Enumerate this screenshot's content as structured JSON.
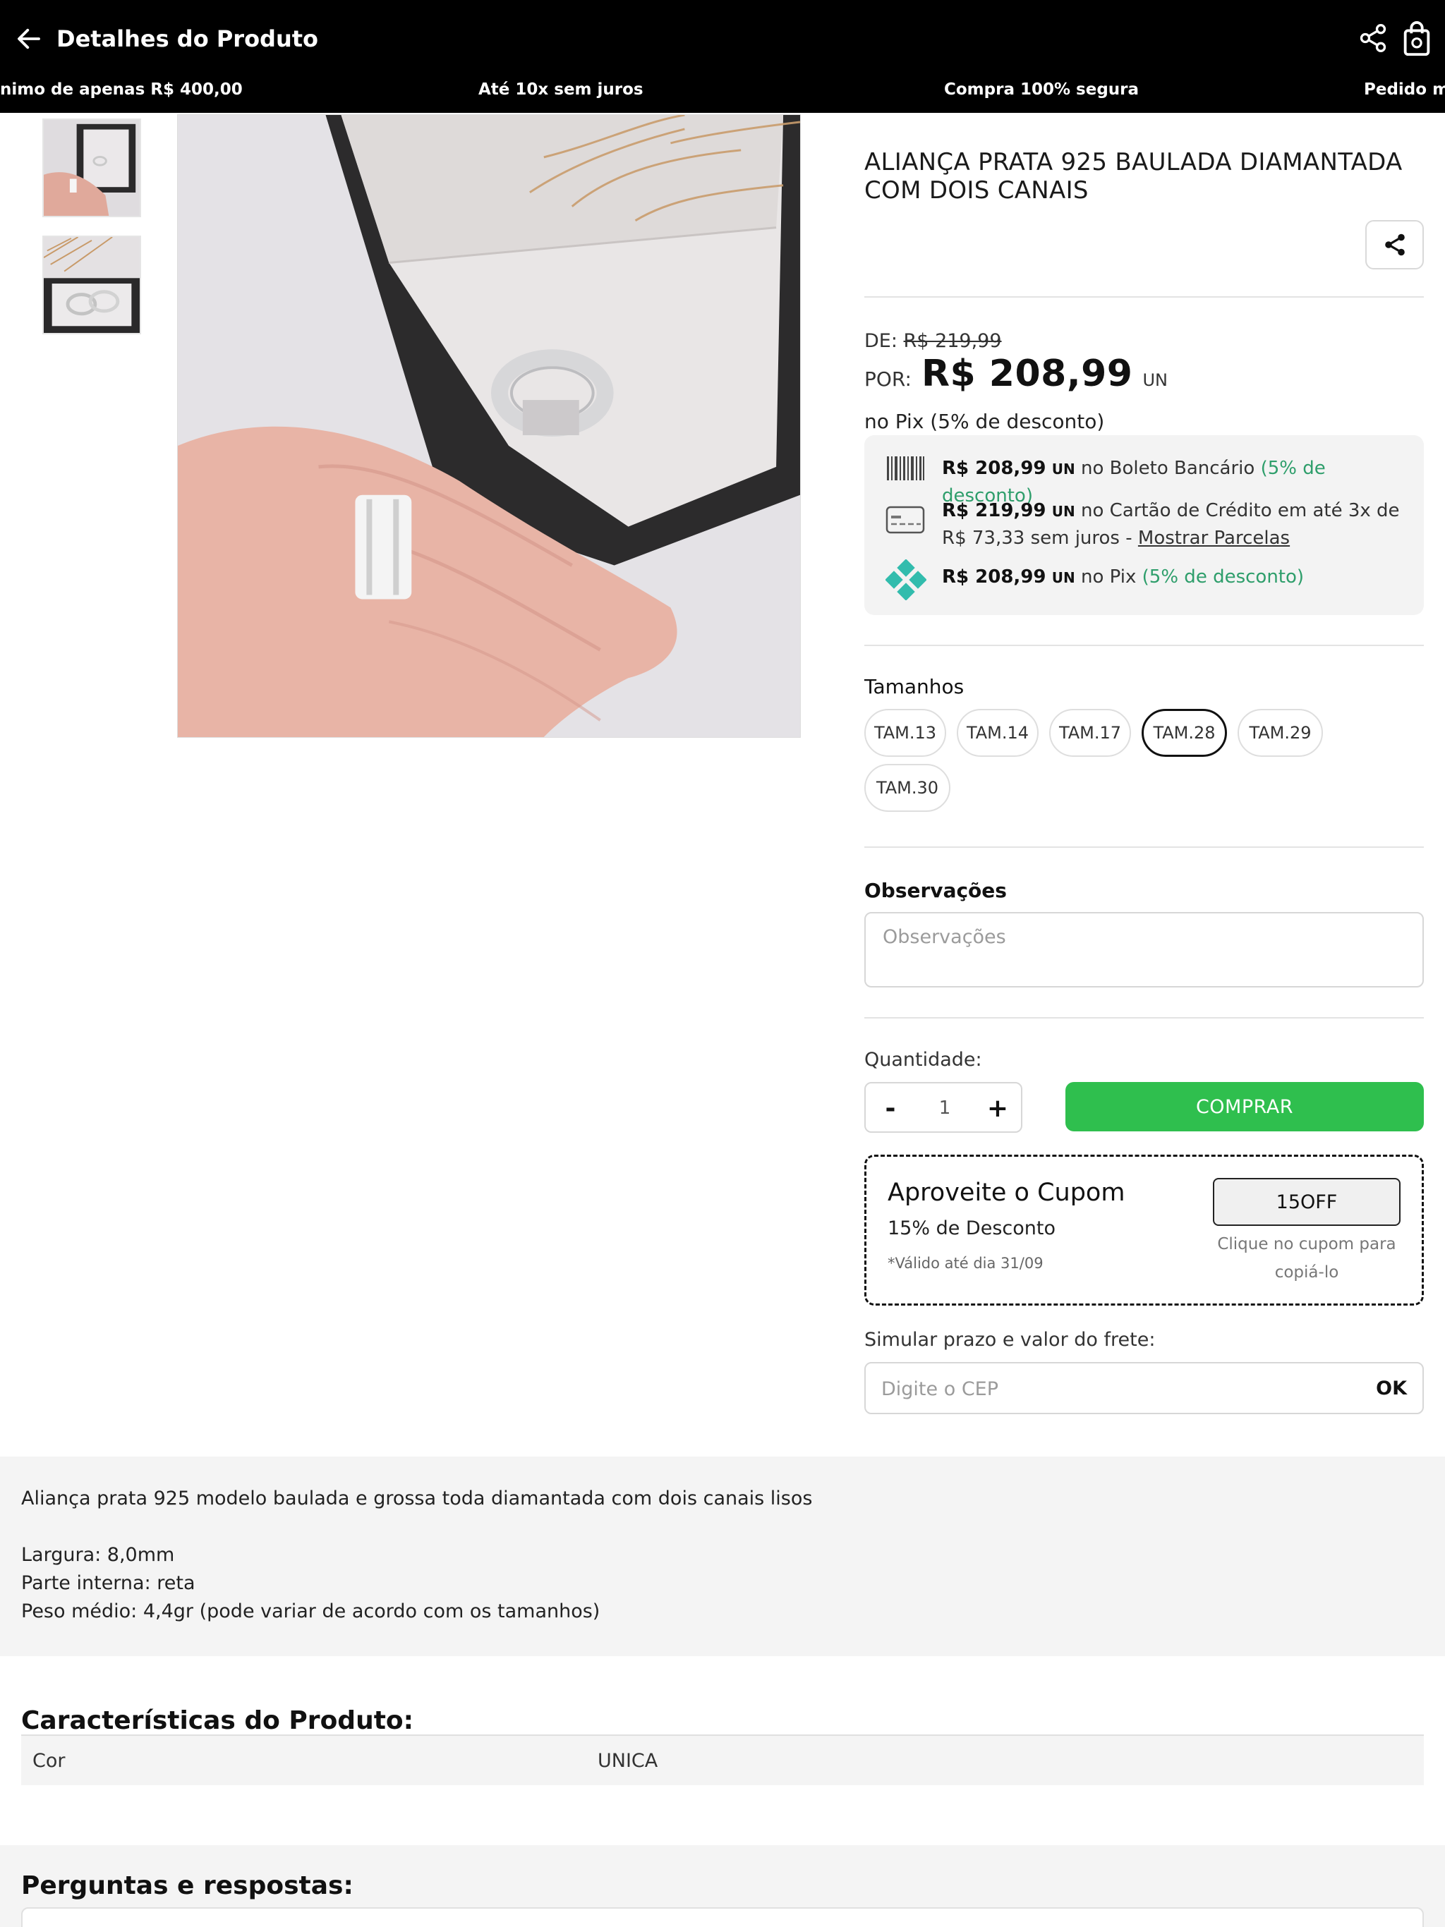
{
  "header": {
    "title": "Detalhes do Produto"
  },
  "ticker": [
    "nimo de apenas R$ 400,00",
    "Até 10x sem juros",
    "Compra 100% segura",
    "Pedido mí"
  ],
  "product": {
    "title": "ALIANÇA PRATA 925 BAULADA DIAMANTADA COM DOIS CANAIS",
    "price": {
      "de_label": "DE:",
      "de_value": "R$ 219,99",
      "por_label": "POR:",
      "por_value": "R$ 208,99",
      "unit": "UN",
      "pix_note": "no Pix (5% de desconto)"
    },
    "payment": {
      "boleto": {
        "value": "R$ 208,99",
        "unit": "UN",
        "text": "no Boleto Bancário",
        "discount": "(5% de desconto)"
      },
      "card": {
        "value": "R$ 219,99",
        "unit": "UN",
        "text": "no Cartão de Crédito em até 3x de R$ 73,33 sem juros -",
        "link": "Mostrar Parcelas"
      },
      "pix": {
        "value": "R$ 208,99",
        "unit": "UN",
        "text": "no Pix",
        "discount": "(5% de desconto)"
      }
    },
    "sizes": {
      "label": "Tamanhos",
      "options": [
        "TAM.13",
        "TAM.14",
        "TAM.17",
        "TAM.28",
        "TAM.29",
        "TAM.30"
      ],
      "selected": "TAM.28"
    },
    "observations": {
      "label": "Observações",
      "placeholder": "Observações",
      "value": ""
    },
    "quantity": {
      "label": "Quantidade:",
      "minus": "-",
      "value": "1",
      "plus": "+"
    },
    "buy_label": "COMPRAR",
    "coupon": {
      "title": "Aproveite o Cupom",
      "subtitle": "15% de Desconto",
      "valid": "*Válido até dia 31/09",
      "code": "15OFF",
      "hint": "Clique no cupom para copiá-lo"
    },
    "shipping": {
      "label": "Simular prazo e valor do frete:",
      "placeholder": "Digite o CEP",
      "ok": "OK"
    }
  },
  "description": {
    "lines": [
      "Aliança prata 925 modelo baulada e grossa toda diamantada com dois canais lisos",
      "Largura: 8,0mm",
      "Parte interna: reta",
      "Peso médio: 4,4gr (pode variar de acordo com os tamanhos)"
    ]
  },
  "characteristics": {
    "title": "Características do Produto:",
    "rows": [
      {
        "name": "Cor",
        "value": "UNICA"
      }
    ]
  },
  "qa": {
    "title": "Perguntas e respostas:"
  },
  "colors": {
    "buy": "#2fbf4e",
    "discount": "#2e9e6b",
    "pix": "#32bcad",
    "header": "#000000"
  },
  "icons": [
    "arrow-left-icon",
    "share-icon",
    "shopping-bag-icon",
    "barcode-icon",
    "credit-card-icon",
    "pix-icon"
  ]
}
